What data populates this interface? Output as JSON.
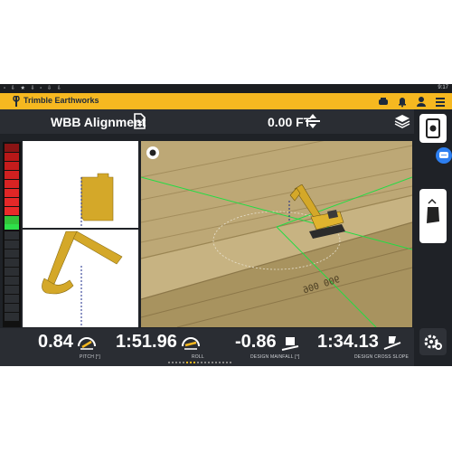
{
  "statusbar": {
    "left_icons": "▫ ⇩ ★ ⇩ ▫ ⇩ ⇩",
    "time": "9:17"
  },
  "appbar": {
    "title": "Trimble Earthworks",
    "brand_color": "#f6b820"
  },
  "header": {
    "design_name": "WBB Alignment",
    "offset_value": "0.00 FT"
  },
  "plan_view": {
    "station_label": "900 006"
  },
  "metrics": [
    {
      "value": "0.84",
      "label": "PITCH [°]",
      "icon": "pitch-gauge-icon"
    },
    {
      "value": "1:51.96",
      "label": "ROLL",
      "icon": "roll-gauge-icon"
    },
    {
      "value": "-0.86",
      "label": "DESIGN MAINFALL [°]",
      "icon": "mainfall-icon"
    },
    {
      "value": "1:34.13",
      "label": "DESIGN CROSS SLOPE",
      "icon": "cross-slope-icon"
    }
  ],
  "colors": {
    "machine": "#d4a829",
    "terrain": "#bda876",
    "design_line": "#22dd44",
    "panel": "#2a2d33"
  }
}
